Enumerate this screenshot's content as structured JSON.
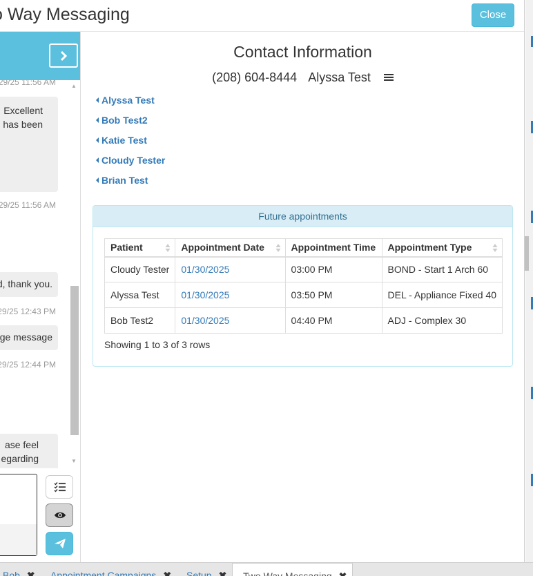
{
  "header": {
    "title": "o Way Messaging",
    "close_label": "Close"
  },
  "conversation": {
    "messages": [
      {
        "timestamp": "29/25 11:56 AM"
      },
      {
        "lines": [
          "Excellent",
          "has been"
        ]
      },
      {
        "timestamp": "29/25 11:56 AM"
      },
      {
        "lines": [
          "d, thank you."
        ]
      },
      {
        "timestamp": "29/25 12:43 PM"
      },
      {
        "lines": [
          "ge message"
        ]
      },
      {
        "timestamp": "29/25 12:44 PM"
      },
      {
        "lines": [
          "ase feel",
          "egarding"
        ]
      }
    ]
  },
  "contact": {
    "title": "Contact Information",
    "phone": "(208) 604-8444",
    "name": "Alyssa Test",
    "links": [
      "Alyssa Test",
      "Bob Test2",
      "Katie Test",
      "Cloudy Tester",
      "Brian Test"
    ]
  },
  "appointments": {
    "heading": "Future appointments",
    "columns": [
      "Patient",
      "Appointment Date",
      "Appointment Time",
      "Appointment Type"
    ],
    "rows": [
      [
        "Cloudy Tester",
        "01/30/2025",
        "03:00 PM",
        "BOND - Start 1 Arch 60"
      ],
      [
        "Alyssa Test",
        "01/30/2025",
        "03:50 PM",
        "DEL - Appliance Fixed 40"
      ],
      [
        "Bob Test2",
        "01/30/2025",
        "04:40 PM",
        "ADJ - Complex 30"
      ]
    ],
    "footer": "Showing 1 to 3 of 3 rows"
  },
  "tabs": [
    {
      "label": "Bob"
    },
    {
      "label": "Appointment Campaigns"
    },
    {
      "label": "Setup"
    },
    {
      "label": "Two Way Messaging",
      "active": true
    }
  ],
  "colors": {
    "accent": "#5bc0de",
    "link": "#337ab7",
    "panel_heading": "#d9edf7"
  }
}
